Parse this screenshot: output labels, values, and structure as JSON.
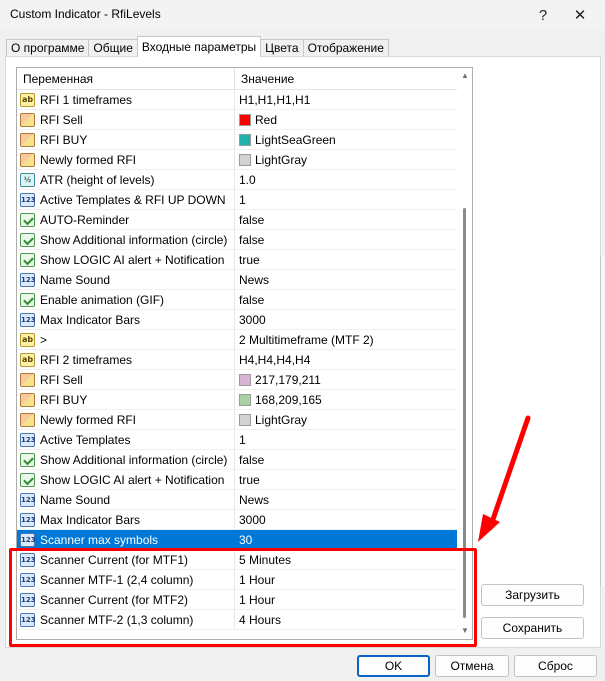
{
  "window": {
    "title": "Custom Indicator - RfiLevels",
    "help_label": "?",
    "close_label": "✕"
  },
  "tabs": [
    {
      "label": "О программе"
    },
    {
      "label": "Общие"
    },
    {
      "label": "Входные параметры"
    },
    {
      "label": "Цвета"
    },
    {
      "label": "Отображение"
    }
  ],
  "grid": {
    "header_var": "Переменная",
    "header_val": "Значение",
    "rows": [
      {
        "icon": "ab",
        "name": "RFI 1 timeframes",
        "value": "H1,H1,H1,H1"
      },
      {
        "icon": "color",
        "name": "RFI Sell",
        "value": "Red",
        "swatch": "#ff0000"
      },
      {
        "icon": "color",
        "name": "RFI BUY",
        "value": "LightSeaGreen",
        "swatch": "#20b2aa"
      },
      {
        "icon": "color",
        "name": "Newly formed RFI",
        "value": "LightGray",
        "swatch": "#d3d3d3"
      },
      {
        "icon": "dbl",
        "name": "ATR (height of levels)",
        "value": "1.0"
      },
      {
        "icon": "num",
        "name": "Active Templates & RFI UP DOWN",
        "value": "1"
      },
      {
        "icon": "bool",
        "name": "AUTO-Reminder",
        "value": "false"
      },
      {
        "icon": "bool",
        "name": "Show Additional information (circle)",
        "value": "false"
      },
      {
        "icon": "bool",
        "name": "Show LOGIC AI alert + Notification",
        "value": "true"
      },
      {
        "icon": "num",
        "name": "Name Sound",
        "value": "News"
      },
      {
        "icon": "bool",
        "name": "Enable animation (GIF)",
        "value": "false"
      },
      {
        "icon": "num",
        "name": "Max Indicator Bars",
        "value": "3000"
      },
      {
        "icon": "ab",
        "name": ">",
        "value": "2 Multitimeframe (MTF 2)"
      },
      {
        "icon": "ab",
        "name": "RFI 2 timeframes",
        "value": "H4,H4,H4,H4"
      },
      {
        "icon": "color",
        "name": "RFI Sell",
        "value": "217,179,211",
        "swatch": "#d9b3d3"
      },
      {
        "icon": "color",
        "name": "RFI BUY",
        "value": "168,209,165",
        "swatch": "#a8d1a5"
      },
      {
        "icon": "color",
        "name": "Newly formed RFI",
        "value": "LightGray",
        "swatch": "#d3d3d3"
      },
      {
        "icon": "num",
        "name": "Active Templates",
        "value": "1"
      },
      {
        "icon": "bool",
        "name": "Show Additional information (circle)",
        "value": "false"
      },
      {
        "icon": "bool",
        "name": "Show LOGIC AI alert + Notification",
        "value": "true"
      },
      {
        "icon": "num",
        "name": "Name Sound",
        "value": "News"
      },
      {
        "icon": "num",
        "name": "Max Indicator Bars",
        "value": "3000"
      },
      {
        "icon": "num",
        "name": "Scanner max symbols",
        "value": "30",
        "selected": true
      },
      {
        "icon": "enum",
        "name": "Scanner Current (for MTF1)",
        "value": "5 Minutes"
      },
      {
        "icon": "enum",
        "name": "Scanner MTF-1 (2,4 column)",
        "value": "1 Hour"
      },
      {
        "icon": "enum",
        "name": "Scanner Current (for MTF2)",
        "value": "1 Hour"
      },
      {
        "icon": "enum",
        "name": "Scanner MTF-2 (1,3 column)",
        "value": "4 Hours"
      }
    ]
  },
  "buttons": {
    "load": "Загрузить",
    "save": "Сохранить",
    "ok": "OK",
    "cancel": "Отмена",
    "reset": "Сброс"
  },
  "colors": {
    "selection": "#0078d7",
    "annotation": "#ff0000"
  }
}
